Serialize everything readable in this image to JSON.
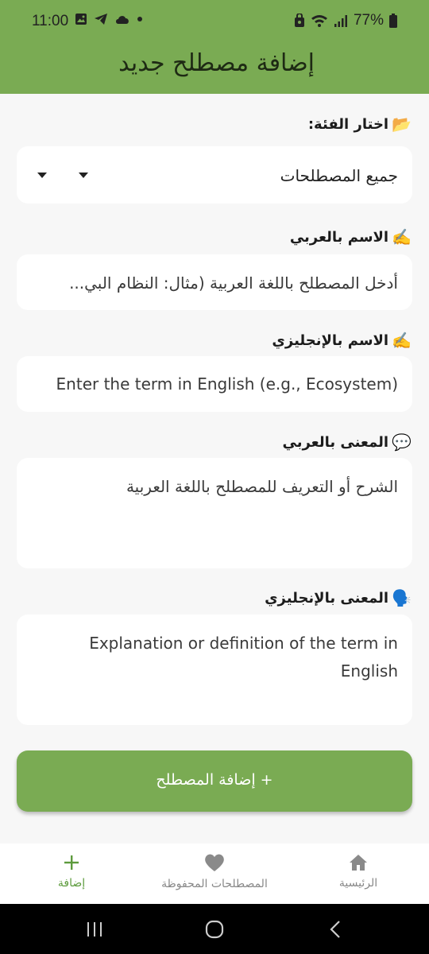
{
  "status_bar": {
    "time": "11:00",
    "battery": "77%"
  },
  "header": {
    "title": "إضافة مصطلح جديد"
  },
  "category": {
    "label": "اختار الفئة:",
    "icon": "folder-icon",
    "selected": "جميع المصطلحات"
  },
  "arabic_name": {
    "label": "الاسم بالعربي",
    "icon": "writing-hand-icon",
    "placeholder": "أدخل المصطلح باللغة العربية (مثال: النظام البي..."
  },
  "english_name": {
    "label": "الاسم بالإنجليزي",
    "icon": "writing-hand-icon",
    "placeholder": "Enter the term in English (e.g., Ecosystem)"
  },
  "arabic_meaning": {
    "label": "المعنى بالعربي",
    "icon": "speech-bubble-icon",
    "placeholder": "الشرح أو التعريف للمصطلح باللغة العربية"
  },
  "english_meaning": {
    "label": "المعنى بالإنجليزي",
    "icon": "speaking-head-icon",
    "placeholder_line1": "Explanation or definition of the term in",
    "placeholder_line2": "English"
  },
  "add_button": {
    "label": "+  إضافة المصطلح"
  },
  "bottom_nav": {
    "home": "الرئيسية",
    "saved": "المصطلحات المحفوظة",
    "add": "إضافة"
  },
  "colors": {
    "primary": "#7aab53",
    "active_nav": "#5d9b3d",
    "background": "#f7f7f7"
  }
}
